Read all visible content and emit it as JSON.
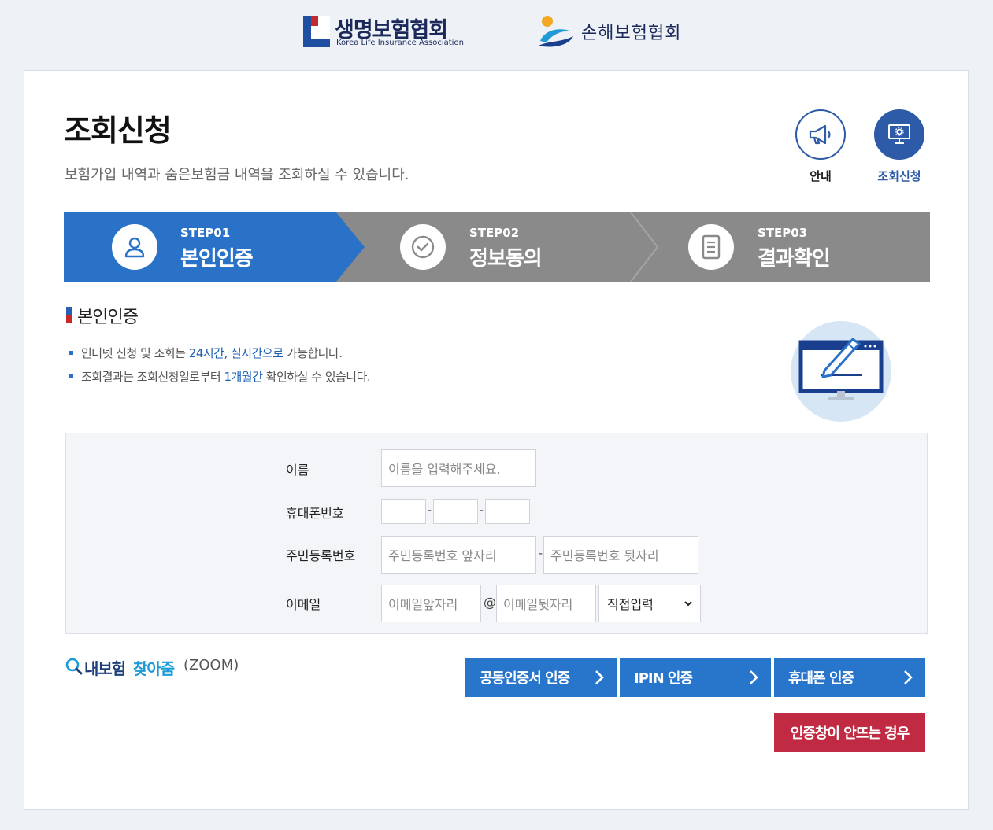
{
  "header": {
    "logo_life": {
      "name": "생명보험협회",
      "sub": "Korea Life Insurance Association"
    },
    "logo_nonlife": {
      "name": "손해보험협회"
    }
  },
  "page": {
    "title": "조회신청",
    "description": "보험가입 내역과 숨은보험금 내역을 조회하실 수 있습니다."
  },
  "top_buttons": {
    "guide_label": "안내",
    "apply_label": "조회신청"
  },
  "steps": [
    {
      "num": "STEP01",
      "name": "본인인증",
      "icon": "user-icon",
      "active": true
    },
    {
      "num": "STEP02",
      "name": "정보동의",
      "icon": "check-circle-icon",
      "active": false
    },
    {
      "num": "STEP03",
      "name": "결과확인",
      "icon": "document-icon",
      "active": false
    }
  ],
  "section": {
    "title": "본인인증",
    "notes": [
      {
        "pre": "인터넷 신청 및 조회는 ",
        "hl": "24시간, 실시간으로",
        "post": " 가능합니다."
      },
      {
        "pre": "조회결과는 조회신청일로부터 ",
        "hl": "1개월간",
        "post": " 확인하실 수 있습니다."
      }
    ]
  },
  "form": {
    "name_label": "이름",
    "name_placeholder": "이름을 입력해주세요.",
    "phone_label": "휴대폰번호",
    "phone_sep": "-",
    "rrn_label": "주민등록번호",
    "rrn_front_placeholder": "주민등록번호 앞자리",
    "rrn_back_placeholder": "주민등록번호 뒷자리",
    "email_label": "이메일",
    "email_front_placeholder": "이메일앞자리",
    "email_at": "@",
    "email_back_placeholder": "이메일뒷자리",
    "email_domain_selected": "직접입력"
  },
  "zoom_link": {
    "part1": "내보험",
    "part2": "찾아줌",
    "part3": "(ZOOM)"
  },
  "actions": {
    "cert_label": "공동인증서 인증",
    "ipin_label": "IPIN 인증",
    "phone_label": "휴대폰 인증",
    "fail_label": "인증창이 안뜨는 경우"
  },
  "colors": {
    "primary": "#2876cc",
    "step_active": "#2a72c8",
    "step_inactive": "#8a8a8a",
    "danger": "#c02a42",
    "navy": "#1b2a5a"
  }
}
